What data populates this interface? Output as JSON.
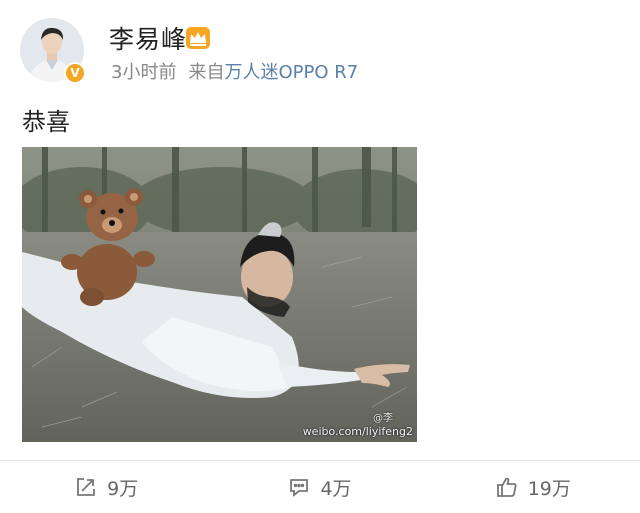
{
  "user": {
    "name": "李易峰",
    "verified_badge": "V"
  },
  "meta": {
    "time": "3小时前",
    "source_prefix": "来自",
    "source": "万人迷OPPO R7"
  },
  "post": {
    "text": "恭喜",
    "image": {
      "watermark_handle": "@李",
      "watermark_url": "weibo.com/liyifeng2"
    }
  },
  "actions": {
    "repost": "9万",
    "comment": "4万",
    "like": "19万"
  },
  "colors": {
    "link": "#5b7fab",
    "meta": "#888888",
    "verified": "#f5a623",
    "crown": "#f5a623"
  },
  "icons": [
    "verified-badge-icon",
    "crown-icon",
    "repost-icon",
    "comment-icon",
    "like-icon"
  ]
}
